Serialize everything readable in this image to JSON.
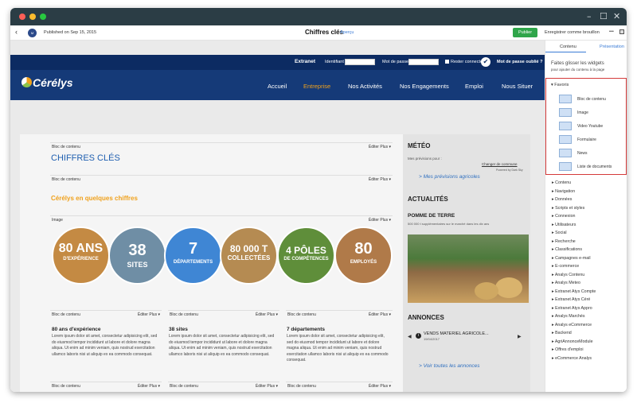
{
  "editor": {
    "published": "Published on Sep 15, 2015",
    "avatar": "M",
    "page_title": "Chiffres clés",
    "preview": "Aperçu",
    "publish": "Publier",
    "save_draft": "Enregistrer comme brouillon",
    "more": "•••",
    "back": "‹"
  },
  "site": {
    "topbar": {
      "extranet": "Extranet",
      "identifiant": "Identifiant",
      "password": "Mot de passe",
      "remember": "Rester connecté",
      "forgot": "Mot de passe oublié ?"
    },
    "logo": "Cérélys",
    "nav": [
      "Accueil",
      "Entreprise",
      "Nos Activités",
      "Nos Engagements",
      "Emploi",
      "Nous Situer"
    ]
  },
  "blocks": {
    "bloc_contenu": "Bloc de contenu",
    "image": "Image",
    "edit": "Éditer",
    "plus": "Plus ▾"
  },
  "main": {
    "title": "CHIFFRES CLÉS",
    "subtitle": "Cérélys en quelques chiffres",
    "circles": [
      {
        "big": "80 ANS",
        "small": "D'EXPÉRIENCE",
        "color": "#c48a43"
      },
      {
        "big": "38",
        "small": "SITES",
        "color": "#6f8ea5"
      },
      {
        "big": "7",
        "small": "DÉPARTEMENTS",
        "color": "#3f86d4"
      },
      {
        "big": "80 000 T",
        "small": "COLLECTÉES",
        "color": "#b58b52"
      },
      {
        "big": "4 PÔLES",
        "small": "DE COMPÉTENCES",
        "color": "#5f8e3a"
      },
      {
        "big": "80",
        "small": "EMPLOYÉS",
        "color": "#b07a49"
      }
    ],
    "columns": [
      {
        "title": "80 ans d'expérience",
        "text": "Lorem ipsum dolor sit amet, consectetur adipisicing elit, sed do eiusmod tempor incididunt ut labore et dolore magna aliqua. Ut enim ad minim veniam, quis nostrud exercitation ullamco laboris nisi ut aliquip ex ea commodo consequat."
      },
      {
        "title": "38 sites",
        "text": "Lorem ipsum dolor sit amet, consectetur adipisicing elit, sed do eiusmod tempor incididunt ut labore et dolore magna aliqua. Ut enim ad minim veniam, quis nostrud exercitation ullamco laboris nisi ut aliquip ex ea commodo consequat."
      },
      {
        "title": "7 départements",
        "text": "Lorem ipsum dolor sit amet, consectetur adipisicing elit, sed do eiusmod tempor incididunt ut labore et dolore magna aliqua. Ut enim ad minim veniam, quis nostrud exercitation ullamco laboris nisi ut aliquip ex ea commodo consequat."
      }
    ]
  },
  "sidebar": {
    "meteo": "MÉTÉO",
    "previsions": "Mes prévisions pour :",
    "changer": "Changer de commune",
    "powered": "Powered by Dark Sky",
    "agricoles": "> Mes prévisions agricoles",
    "actualites": "ACTUALITÉS",
    "news_title": "POMME DE TERRE",
    "news_text": "500 000 t supplémentaires sur le marché dans les dix ans",
    "annonces": "ANNONCES",
    "annonce_title": "VENDS MATERIEL AGRICOLE...",
    "annonce_date": "19/04/2017",
    "voir": "> Voir toutes les annonces"
  },
  "panel": {
    "tabs": [
      "Contenu",
      "Présentation"
    ],
    "intro": "Faites glisser les widgets",
    "intro2": "pour ajouter du contenu à la page",
    "favoris": "Favoris",
    "widgets": [
      "Bloc de contenu",
      "Image",
      "Video Youtube",
      "Formulaire",
      "News",
      "Liste de documents"
    ],
    "categories": [
      "Contenu",
      "Navigation",
      "Données",
      "Scripts et styles",
      "Connexion",
      "Utilisateurs",
      "Social",
      "Recherche",
      "Classifications",
      "Campagnes e-mail",
      "E-commerce",
      "Analys Contenu",
      "Analys Meteo",
      "Extranet Atys Compte",
      "Extranet Atys Céré",
      "Extranet Atys Appro",
      "Analys Marchés",
      "Analys eCommerce",
      "Backend",
      "AgriAnnonceModule",
      "Offres d'emploi",
      "eCommerce Analys"
    ]
  },
  "colors": {
    "brand_dark": "#0c2b62",
    "brand": "#153a78",
    "accent_orange": "#f0a11c",
    "title_blue": "#1f5fb0",
    "publish_green": "#2fa54a",
    "highlight_red": "#d43a3a"
  }
}
